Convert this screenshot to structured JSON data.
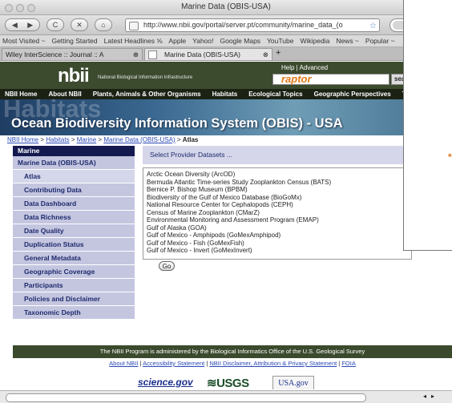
{
  "window": {
    "title": "Marine Data (OBIS-USA)"
  },
  "nav": {
    "back": "◀",
    "forward": "▶",
    "reload": "C",
    "stop": "✕",
    "home": "⌂",
    "url": "http://www.nbii.gov/portal/server.pt/community/marine_data_(o",
    "search_placeholder": "Go"
  },
  "bookmarks": [
    "Most Visited ~",
    "Getting Started",
    "Latest Headlines ⅝",
    "Apple",
    "Yahoo!",
    "Google Maps",
    "YouTube",
    "Wikipedia",
    "News ~",
    "Popular ~"
  ],
  "tabs": [
    {
      "label": "Wiley InterScience :: Journal :: A"
    },
    {
      "label": "Marine Data (OBIS-USA)"
    }
  ],
  "new_tab": "+",
  "site": {
    "logo_text": "nbii",
    "logo_sub": "National Biological Information Infrastructure",
    "help_link": "Help | Advanced",
    "search_brand": "raptor",
    "search_btn": "sea",
    "toplinks": [
      "NBII Home",
      "About NBII",
      "Plants, Animals & Other Organisms",
      "Habitats",
      "Ecological Topics",
      "Geographic Perspectives",
      "T"
    ],
    "banner_bg_word": "Habitats",
    "banner_title": "Ocean Biodiversity Information System (OBIS) - USA"
  },
  "breadcrumb": {
    "items": [
      "NBII Home",
      "Habitats",
      "Marine",
      "Marine Data (OBIS-USA)"
    ],
    "current": "Atlas"
  },
  "sidebar": {
    "header": "Marine",
    "top_item": "Marine Data (OBIS-USA)",
    "items": [
      "Atlas",
      "Contributing Data",
      "Data Dashboard",
      "Data Richness",
      "Date Quality",
      "Duplication Status",
      "General Metadata",
      "Geographic Coverage",
      "Participants",
      "Policies and Disclaimer",
      "Taxonomic Depth"
    ]
  },
  "main": {
    "header": "Select Provider Datasets ...",
    "datasets": [
      "Arctic Ocean Diversity (ArcOD)",
      "Bermuda Atlantic Time-series Study Zooplankton Census (BATS)",
      "Bernice P. Bishop Museum (BPBM)",
      "Biodiversity of the Gulf of Mexico Database (BioGoMx)",
      "National Resource Center for Cephalopods (CEPH)",
      "Census of Marine Zooplankton (CMarZ)",
      "Environmental Monitoring and Assessment Program (EMAP)",
      "Gulf of Alaska (GOA)",
      "Gulf of Mexico - Amphipods (GoMexAmphipod)",
      "Gulf of Mexico - Fish (GoMexFish)",
      "Gulf of Mexico - Invert (GoMexInvert)"
    ],
    "go_button": "Go"
  },
  "footer": {
    "line": "The NBII Program is administered by the Biological Informatics Office of the U.S. Geological Survey",
    "links": [
      "About NBII",
      "Accessibility Statement",
      "NBII Disclaimer, Attribution & Privacy Statement",
      "FOIA"
    ],
    "logos": [
      "science.gov",
      "USGS",
      "USA.gov"
    ]
  },
  "overlay": {
    "mark": "*"
  }
}
